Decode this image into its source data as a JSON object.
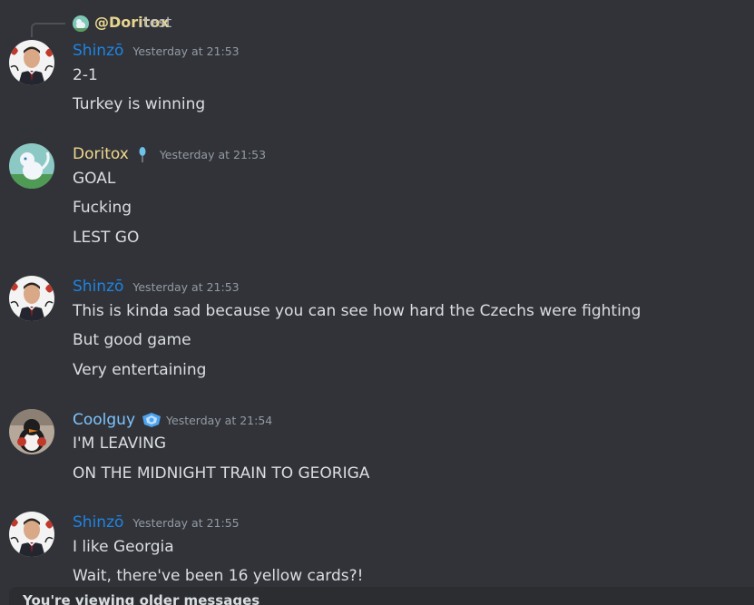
{
  "reply": {
    "username": "@Doritox",
    "text": ":test"
  },
  "messages": [
    {
      "username": "Shinzō",
      "timestamp": "Yesterday at 21:53",
      "lines": [
        "2-1",
        "Turkey is winning"
      ]
    },
    {
      "username": "Doritox",
      "timestamp": "Yesterday at 21:53",
      "lines": [
        "GOAL",
        "Fucking",
        "LEST GO"
      ]
    },
    {
      "username": "Shinzō",
      "timestamp": "Yesterday at 21:53",
      "lines": [
        "This is kinda sad because you can see how hard the Czechs were fighting",
        "But good game",
        "Very entertaining"
      ]
    },
    {
      "username": "Coolguy",
      "timestamp": "Yesterday at 21:54",
      "lines": [
        "I'M LEAVING",
        "ON THE MIDNIGHT TRAIN TO GEORIGA"
      ]
    },
    {
      "username": "Shinzō",
      "timestamp": "Yesterday at 21:55",
      "lines": [
        "I like Georgia",
        "Wait, there've been 16 yellow cards?!"
      ]
    }
  ],
  "older_banner": {
    "text": "You're viewing older messages"
  },
  "colors": {
    "background": "#313338",
    "shinzo_name": "#1e84e4",
    "doritox_name": "#f0d78c",
    "coolguy_name": "#7ec4ff",
    "timestamp": "#949ba4",
    "message_text": "#dbdee1"
  }
}
